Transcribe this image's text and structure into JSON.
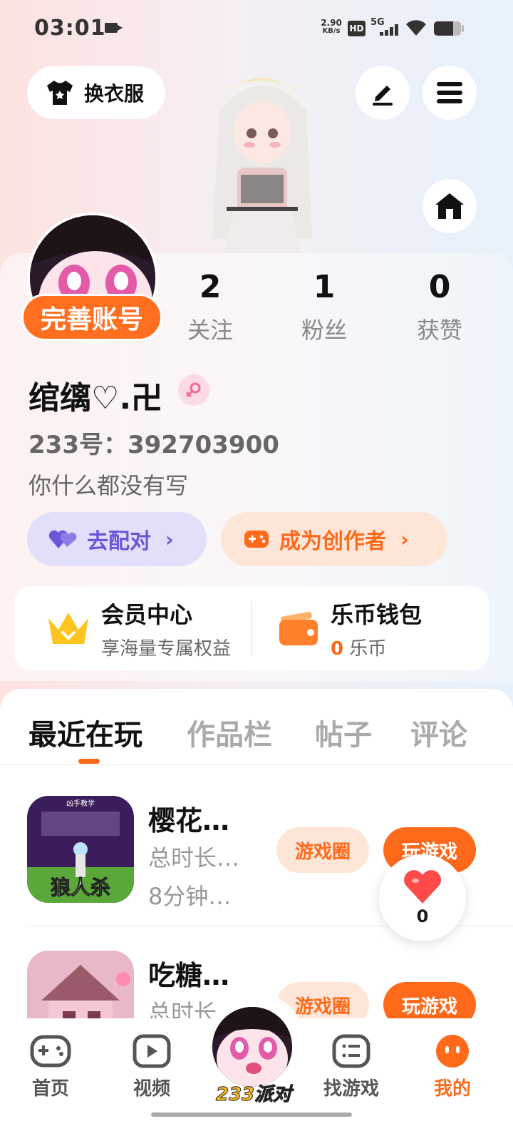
{
  "status_bar": {
    "time": "03:01",
    "speed_value": "2.90",
    "speed_unit": "KB/s",
    "hd_badge": "HD",
    "network": "5G",
    "battery_level": 0.7
  },
  "header": {
    "change_clothes_label": "换衣服"
  },
  "profile": {
    "complete_account_label": "完善账号",
    "stats": [
      {
        "value": "2",
        "label": "关注"
      },
      {
        "value": "1",
        "label": "粉丝"
      },
      {
        "value": "0",
        "label": "获赞"
      }
    ],
    "username": "绾缡♡.卍",
    "uid": "233号：392703900",
    "bio": "你什么都没有写",
    "match_label": "去配对",
    "creator_label": "成为创作者"
  },
  "vip": {
    "member_title": "会员中心",
    "member_sub": "享海量专属权益",
    "wallet_title": "乐币钱包",
    "wallet_amount": "0",
    "wallet_unit": "乐币"
  },
  "tabs": [
    "最近在玩",
    "作品栏",
    "帖子",
    "评论"
  ],
  "games": [
    {
      "name": "樱花…",
      "time": "总时长…",
      "duration": "8分钟…",
      "thumb_text": "狼人杀",
      "thumb_header": "凶手教学",
      "circle_label": "游戏圈",
      "play_label": "玩游戏"
    },
    {
      "name": "吃糖…",
      "time": "总时长…",
      "circle_label": "游戏圈",
      "play_label": "玩游戏"
    }
  ],
  "like_float": {
    "count": "0"
  },
  "bottom_nav": {
    "items": [
      "首页",
      "视频",
      "找游戏",
      "我的"
    ],
    "center_label": "233派对"
  },
  "colors": {
    "accent": "#ff6a1a",
    "match": "#6b55d8"
  }
}
